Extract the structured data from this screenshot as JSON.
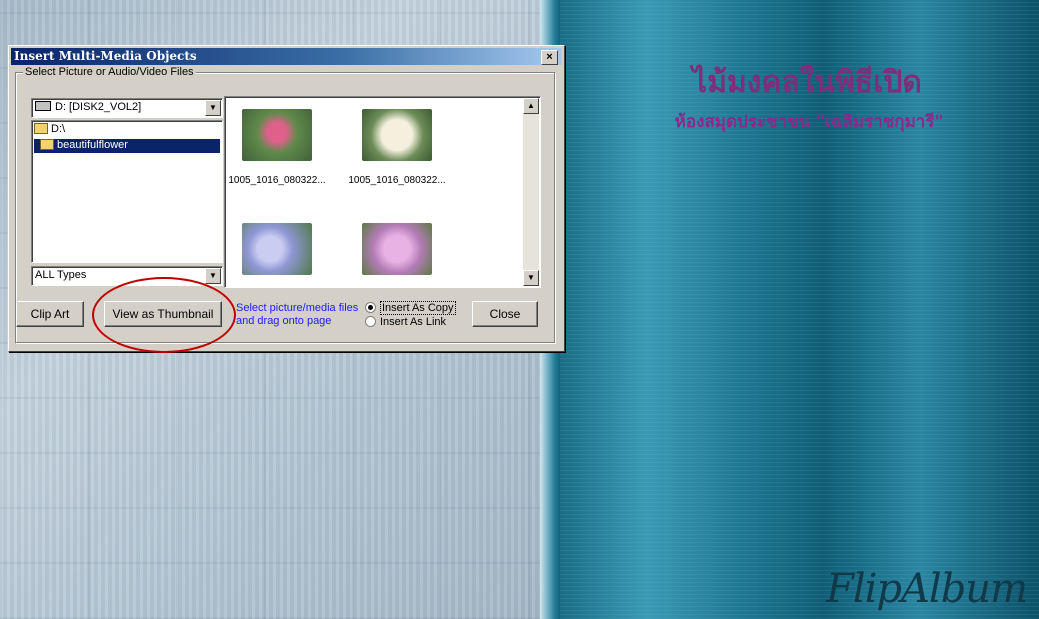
{
  "page": {
    "title": "ไม้มงคลในพิธีเปิด",
    "subtitle": "ห้องสมุดประชาชน \"เฉลิมราชกุมารี\"",
    "logo": "FlipAlbum"
  },
  "dialog": {
    "title": "Insert Multi-Media Objects",
    "close_label": "×",
    "group_label": "Select Picture or Audio/Video Files",
    "drive": "D: [DISK2_VOL2]",
    "dir_items": [
      "D:\\",
      "beautifulflower"
    ],
    "file_type": "ALL Types",
    "thumbnails": [
      {
        "caption": "1005_1016_080322...",
        "color": "#c94a78"
      },
      {
        "caption": "1005_1016_080322...",
        "color": "#e9e4d2"
      },
      {
        "caption": "",
        "color": "#9aa0d8"
      },
      {
        "caption": "",
        "color": "#c48ac6"
      }
    ],
    "clip_art_label": "Clip Art",
    "view_thumbnail_label": "View as Thumbnail",
    "hint_text": "Select picture/media files and drag onto page",
    "insert_copy_label": "Insert As Copy",
    "insert_link_label": "Insert As Link",
    "close_button_label": "Close",
    "insert_mode": "copy"
  },
  "colors": {
    "title_bar": "#0a246a",
    "hint": "#1a1aff",
    "annotation": "#c00000",
    "page_title": "#7d2f7c"
  }
}
